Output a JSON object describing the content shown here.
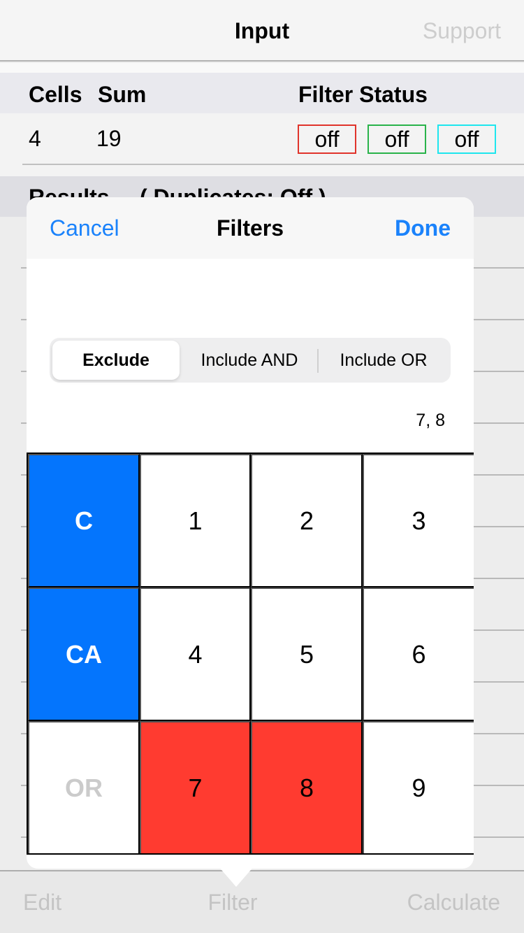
{
  "nav": {
    "title": "Input",
    "support_label": "Support"
  },
  "summary": {
    "headers": {
      "cells": "Cells",
      "sum": "Sum",
      "filter_status": "Filter Status"
    },
    "cells_value": "4",
    "sum_value": "19",
    "filter_badges": [
      {
        "label": "off",
        "color": "#e0342b"
      },
      {
        "label": "off",
        "color": "#29b34a"
      },
      {
        "label": "off",
        "color": "#1ee6ee"
      }
    ]
  },
  "results": {
    "label": "Results",
    "duplicates": "( Duplicates:  Off )"
  },
  "toolbar": {
    "edit_label": "Edit",
    "filter_label": "Filter",
    "calculate_label": "Calculate"
  },
  "popover": {
    "cancel_label": "Cancel",
    "title": "Filters",
    "done_label": "Done",
    "segments": [
      {
        "label": "Exclude",
        "selected": true
      },
      {
        "label": "Include AND",
        "selected": false
      },
      {
        "label": "Include OR",
        "selected": false
      }
    ],
    "selection_summary": "7, 8",
    "keypad": [
      [
        {
          "label": "C",
          "type": "mode",
          "state": "active"
        },
        {
          "label": "1"
        },
        {
          "label": "2"
        },
        {
          "label": "3"
        }
      ],
      [
        {
          "label": "CA",
          "type": "mode",
          "state": "active"
        },
        {
          "label": "4"
        },
        {
          "label": "5"
        },
        {
          "label": "6"
        }
      ],
      [
        {
          "label": "OR",
          "type": "mode",
          "state": "inactive"
        },
        {
          "label": "7",
          "state": "excluded"
        },
        {
          "label": "8",
          "state": "excluded"
        },
        {
          "label": "9"
        }
      ]
    ]
  },
  "colors": {
    "accent_blue": "#1a82fb",
    "mode_active": "#0475fd",
    "excluded_red": "#ff3b30",
    "disabled_grey": "#c4c4c4"
  }
}
